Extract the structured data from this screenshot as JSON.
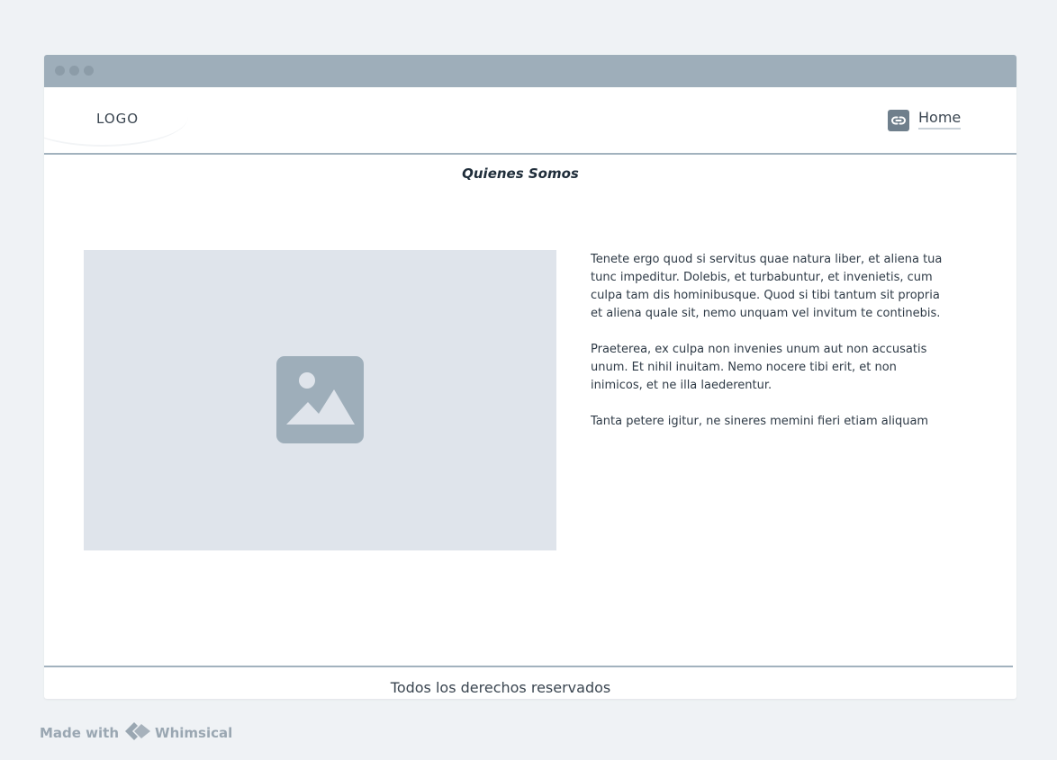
{
  "header": {
    "logo": "LOGO",
    "nav": {
      "link_icon": "link-icon",
      "home_label": "Home"
    }
  },
  "main": {
    "title": "Quienes Somos",
    "image_icon": "image-icon",
    "paragraphs": [
      "Tenete ergo quod si servitus quae natura liber, et aliena tua tunc impeditur. Dolebis, et turbabuntur, et invenietis, cum culpa tam dis hominibusque. Quod si tibi tantum sit propria et aliena quale sit, nemo unquam vel invitum te continebis.",
      "Praeterea, ex culpa non invenies unum aut non accusatis unum. Et nihil inuitam. Nemo nocere tibi erit, et non inimicos, et ne illa laederentur.",
      "Tanta petere igitur, ne sineres memini fieri etiam aliquam"
    ]
  },
  "footer": {
    "text": "Todos los derechos reservados"
  },
  "watermark": {
    "made_with": "Made with",
    "brand": "Whimsical",
    "brand_icon": "whimsical-logo-icon"
  },
  "colors": {
    "page_bg": "#eff2f5",
    "titlebar": "#9eaeba",
    "placeholder": "#dfe4eb",
    "icon": "#9eaeba"
  }
}
